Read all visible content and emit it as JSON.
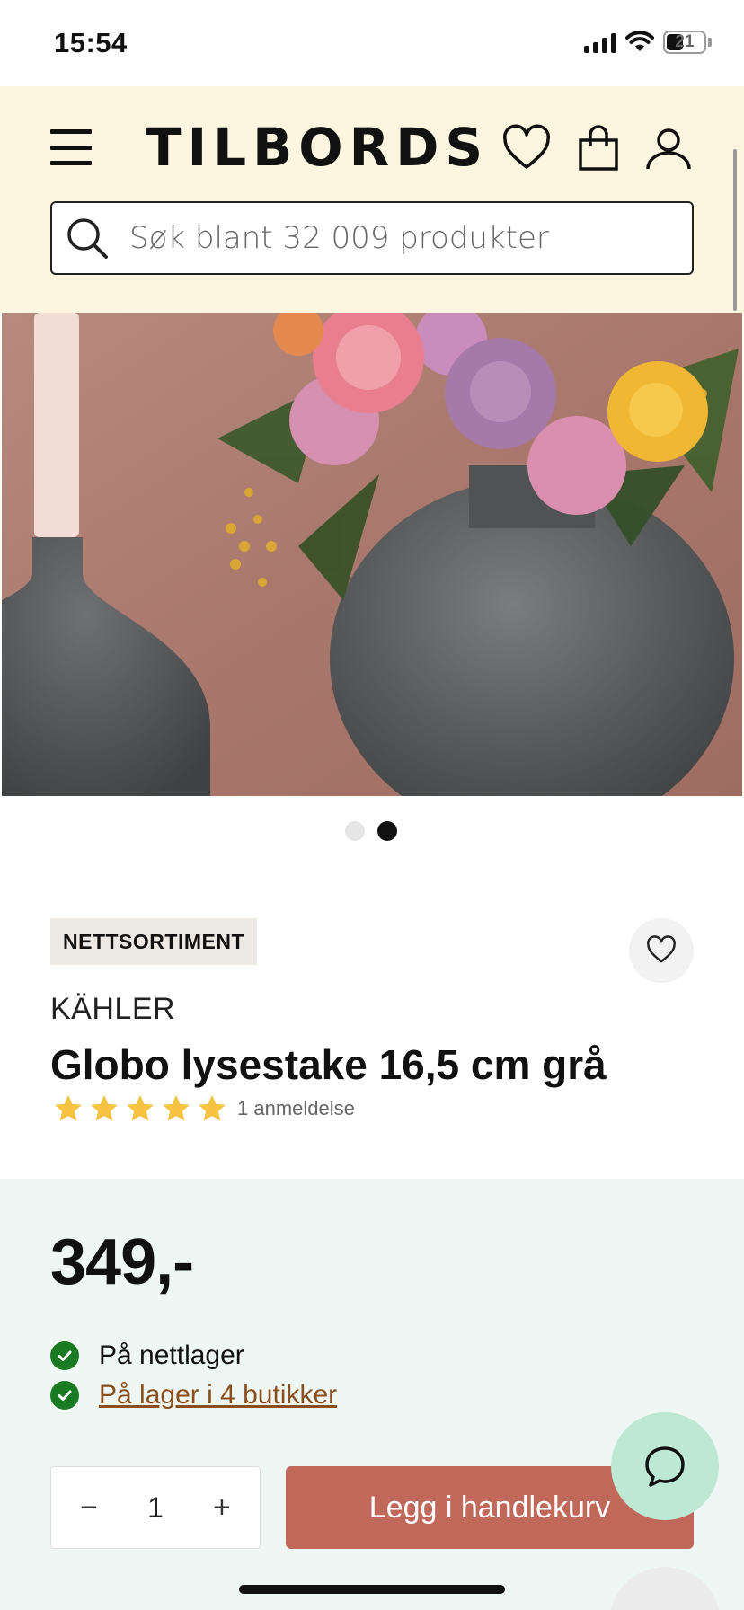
{
  "status_bar": {
    "time": "15:54",
    "battery": "21"
  },
  "header": {
    "logo": "TILBORDS",
    "search": {
      "placeholder": "Søk blant 32 009 produkter"
    },
    "icons": [
      "menu-icon",
      "heart-icon",
      "shopping-bag-icon",
      "user-icon"
    ]
  },
  "gallery": {
    "slide_count": 2,
    "active_slide": 2
  },
  "product": {
    "badge": "NETTSORTIMENT",
    "brand": "KÄHLER",
    "title": "Globo lysestake 16,5 cm grå",
    "rating_stars": 5,
    "review_count": "1 anmeldelse"
  },
  "purchase": {
    "price": "349,-",
    "stock_online": "På nettlager",
    "stock_stores": "På lager i 4 butikker",
    "quantity": "1",
    "add_to_cart": "Legg i handlekurv",
    "minus": "−",
    "plus": "+"
  },
  "colors": {
    "header_bg": "#fcf6e0",
    "price_panel_bg": "#eef7f3",
    "add_to_cart_bg": "#c0695a",
    "stock_check": "#1a7a22",
    "link": "#8a4e1c",
    "chat_bg": "#bde8d3",
    "star": "#f5c242"
  }
}
